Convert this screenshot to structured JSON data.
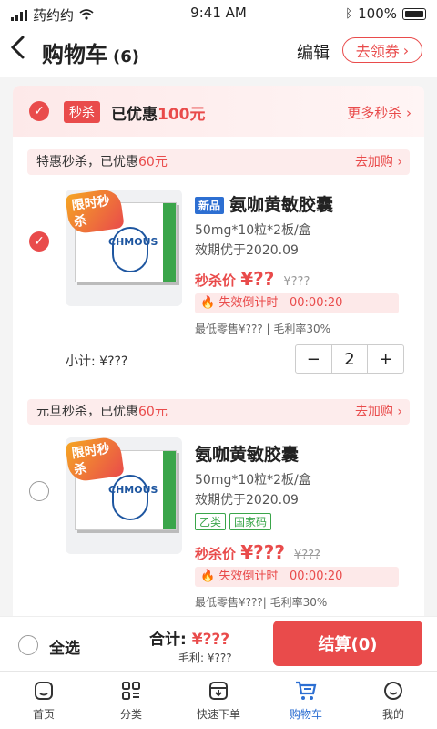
{
  "status_bar": {
    "carrier": "药约约",
    "time": "9:41 AM",
    "battery": "100%"
  },
  "header": {
    "title": "购物车",
    "count": "(6)",
    "edit_label": "编辑",
    "coupon_label": "去领券"
  },
  "promo": {
    "tag": "秒杀",
    "saved_prefix": "已优惠",
    "saved_amount": "100元",
    "more_label": "更多秒杀"
  },
  "groups": [
    {
      "banner_prefix": "特惠秒杀，已优惠",
      "banner_amount": "60元",
      "banner_action": "去加购",
      "product": {
        "badge": "限时秒杀",
        "brand": "CHMOUS",
        "new_tag": "新品",
        "name": "氨咖黄敏胶囊",
        "spec": "50mg*10粒*2板/盒",
        "expiry": "效期优于2020.09",
        "price_label": "秒杀价",
        "price": "¥??",
        "old_price": "¥???",
        "countdown_label": "失效倒计时",
        "countdown": "00:00:20",
        "retail": "最低零售¥??? | 毛利率30%",
        "checked": true
      },
      "subtotal": "小计: ¥???",
      "quantity": "2"
    },
    {
      "banner_prefix": "元旦秒杀，已优惠",
      "banner_amount": "60元",
      "banner_action": "去加购",
      "product": {
        "badge": "限时秒杀",
        "brand": "CHMOUS",
        "name": "氨咖黄敏胶囊",
        "spec": "50mg*10粒*2板/盒",
        "expiry": "效期优于2020.09",
        "tags": [
          "乙类",
          "国家码"
        ],
        "price_label": "秒杀价",
        "price": "¥???",
        "old_price": "¥???",
        "countdown_label": "失效倒计时",
        "countdown": "00:00:20",
        "retail": "最低零售¥???| 毛利率30%",
        "checked": false
      }
    }
  ],
  "footer": {
    "select_all": "全选",
    "total_label": "合计:",
    "total": "¥???",
    "gross_label": "毛利:",
    "gross": "¥???",
    "checkout": "结算(0)"
  },
  "tabs": [
    {
      "label": "首页",
      "icon": "home-icon"
    },
    {
      "label": "分类",
      "icon": "category-icon"
    },
    {
      "label": "快速下单",
      "icon": "quick-order-icon"
    },
    {
      "label": "购物车",
      "icon": "cart-icon",
      "active": true
    },
    {
      "label": "我的",
      "icon": "profile-icon"
    }
  ],
  "colors": {
    "accent": "#e94b4b",
    "primary": "#2d6fd2",
    "green": "#3aa54a"
  }
}
